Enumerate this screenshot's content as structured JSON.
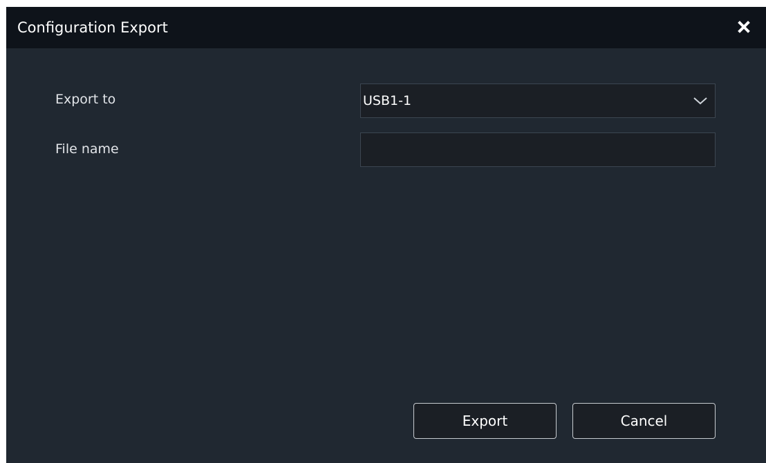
{
  "dialog": {
    "title": "Configuration Export",
    "close_icon": "close-icon"
  },
  "form": {
    "export_to": {
      "label": "Export to",
      "selected": "USB1-1",
      "icon": "chevron-down-icon"
    },
    "file_name": {
      "label": "File name",
      "value": "",
      "placeholder": ""
    }
  },
  "buttons": {
    "export_label": "Export",
    "cancel_label": "Cancel"
  },
  "colors": {
    "dialog_bg": "#202831",
    "titlebar_bg": "#0e131a",
    "field_bg": "#1b1f25",
    "text": "#ffffff"
  }
}
